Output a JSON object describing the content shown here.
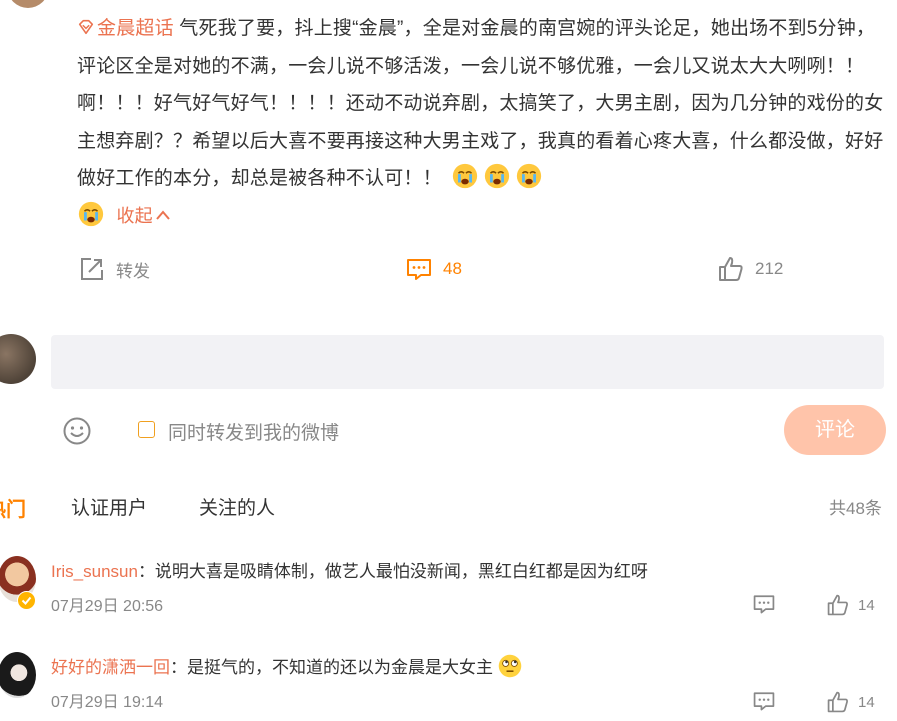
{
  "post": {
    "topic": "金晨超话",
    "text": "气死我了要，抖上搜“金晨”，全是对金晨的南宫婉的评头论足，她出场不到5分钟，评论区全是对她的不满，一会儿说不够活泼，一会儿说不够优雅，一会儿又说太大大咧咧！！啊！！！好气好气好气！！！！还动不动说弃剧，太搞笑了，大男主剧，因为几分钟的戏份的女主想弃剧？？希望以后大喜不要再接这种大男主戏了，我真的看着心疼大喜，什么都没做，好好做好工作的本分，却总是被各种不认可！！",
    "collapse_label": "收起",
    "emojis": [
      "cry-emoji",
      "cry-emoji",
      "cry-emoji",
      "cry-emoji"
    ]
  },
  "actions": {
    "repost_label": "转发",
    "comment_count": "48",
    "like_count": "212"
  },
  "composer": {
    "checkbox_label": "同时转发到我的微博",
    "submit_label": "评论"
  },
  "tabs": {
    "hot": "热门",
    "verified": "认证用户",
    "following": "关注的人",
    "total": "共48条"
  },
  "comments": [
    {
      "name": "Iris_sunsun",
      "text": "：说明大喜是吸睛体制，做艺人最怕没新闻，黑红白红都是因为红呀",
      "time": "07月29日 20:56",
      "likes": "14"
    },
    {
      "name": "好好的潇洒一回",
      "text": "：是挺气的，不知道的还以为金晨是大女主",
      "time": "07月29日 19:14",
      "likes": "14"
    }
  ],
  "colors": {
    "accent": "#eb7350",
    "orange": "#ff8200",
    "submit_bg": "#ffc4aa"
  }
}
